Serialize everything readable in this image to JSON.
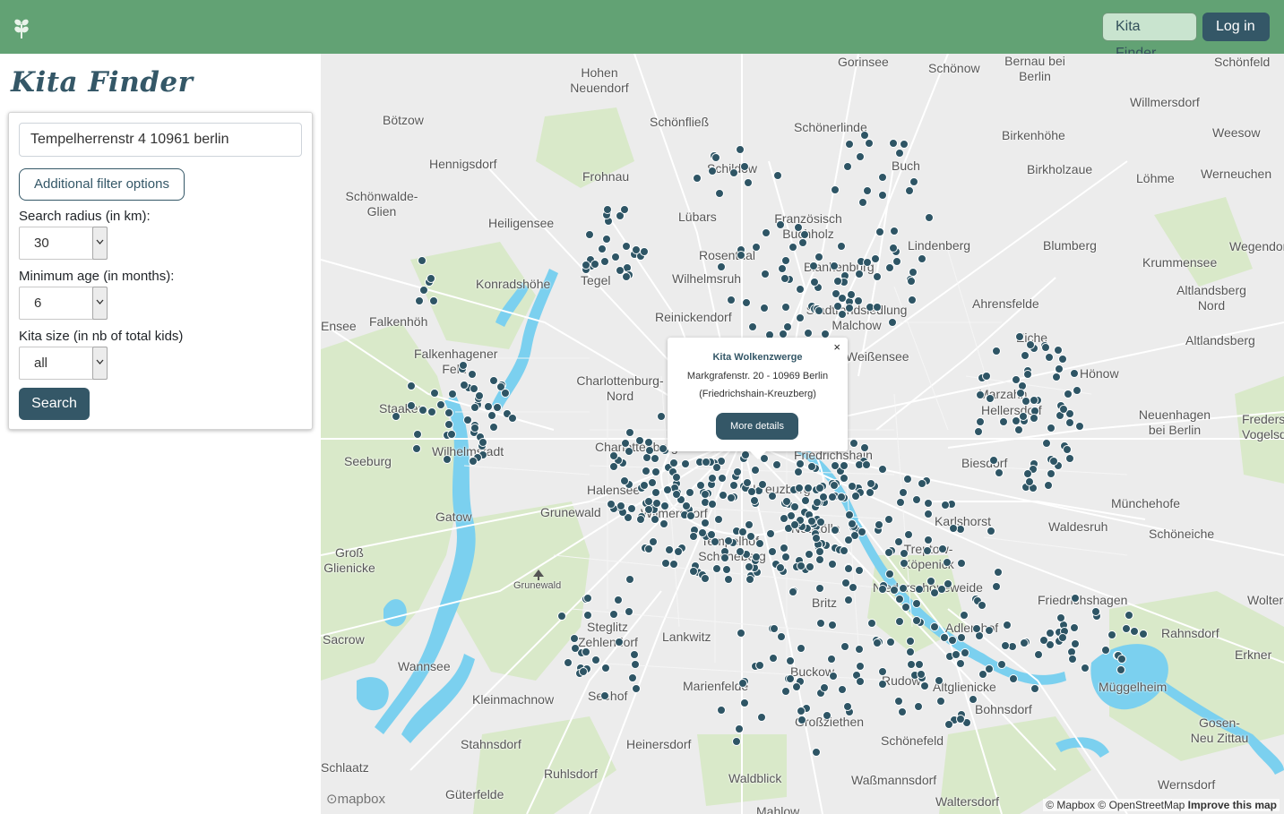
{
  "topbar": {
    "nav_kita_label": "Kita Finder",
    "nav_login_label": "Log in",
    "bar_color": "#62a274"
  },
  "sidebar": {
    "title": "Kita Finder",
    "address_value": "Tempelherrenstr 4 10961 berlin",
    "filter_button_label": "Additional filter options",
    "radius_label": "Search radius (in km):",
    "radius_value": "30",
    "age_label": "Minimum age (in months):",
    "age_value": "6",
    "size_label": "Kita size (in nb of total kids)",
    "size_value": "all",
    "search_button_label": "Search"
  },
  "map": {
    "popup": {
      "name": "Kita Wolkenzwerge",
      "address": "Markgrafenstr. 20 - 10969 Berlin",
      "district": "(Friedrichshain-Kreuzberg)",
      "details_label": "More details",
      "close_symbol": "×"
    },
    "attribution": {
      "mapbox": "© Mapbox",
      "osm": "© OpenStreetMap",
      "improve": "Improve this map"
    },
    "logo_text": "mapbox",
    "places": [
      "Gorinsee",
      "Schönow",
      "Bernau bei Berlin",
      "Schönfeld",
      "Hohen Neuendorf",
      "Willmersdorf",
      "Bötzow",
      "Schönfließ",
      "Schönerlinde",
      "Birkenhöhe",
      "Weesow",
      "Hennigsdorf",
      "Buch",
      "Birkholzaue",
      "Löhme",
      "Werneuchen",
      "Frohnau",
      "Schildow",
      "Schönwalde-Glien",
      "Heiligensee",
      "Lübars",
      "Französisch Buchholz",
      "Lindenberg",
      "Blumberg",
      "Wegendorf",
      "Rosenthal",
      "Krummensee",
      "Blankenburg",
      "Konradshöhe",
      "Tegel",
      "Wilhelmsruh",
      "Altlandsberg Nord",
      "Ahrensfelde",
      "Reinickendorf",
      "Stadtrandsiedlung Malchow",
      "Falkenhöh",
      "Eiche",
      "Altlandsberg",
      "Falkenhagener Feld",
      "Weißensee",
      "Hönow",
      "Charlottenburg-Nord",
      "Marzahn",
      "Hellersdorf",
      "Staaken",
      "Neuenhagen bei Berlin",
      "Fredersdorf-Vogelsdorf",
      "Wilhelmstadt",
      "Charlottenburg",
      "Friedrichshain",
      "Biesdorf",
      "Seeburg",
      "Halensee",
      "Kreuzberg",
      "Grunewald",
      "Wilmersdorf",
      "Münchehofe",
      "Karlshorst",
      "Waldesruh",
      "Gatow",
      "Schöneiche",
      "Tempelhof-Schöneberg",
      "Treptow-Köpenick",
      "Neukölln",
      "Groß Glienicke",
      "Niederschöneweide",
      "Friedrichshagen",
      "Britz",
      "Woltersdorf",
      "Steglitz",
      "Zehlendorf",
      "Adlershof",
      "Rahnsdorf",
      "Sacrow",
      "Lankwitz",
      "Erkner",
      "Wannsee",
      "Buckow",
      "Rudow",
      "Altglienicke",
      "Müggelheim",
      "Marienfelde",
      "Kleinmachnow",
      "Seehof",
      "Bohnsdorf",
      "Großziethen",
      "Gosen-Neu Zittau",
      "Stahnsdorf",
      "Heinersdorf",
      "Schönefeld",
      "Ruhlsdorf",
      "Waldblick",
      "Waßmannsdorf",
      "Wernsdorf",
      "Güterfelde",
      "Waltersdorf",
      "Mahlow",
      "Schlaatz",
      "Ensee"
    ],
    "marker_color": "#2e5565",
    "land_color": "#ececec",
    "water_color": "#75cff0",
    "park_color": "#d8e8c8"
  }
}
